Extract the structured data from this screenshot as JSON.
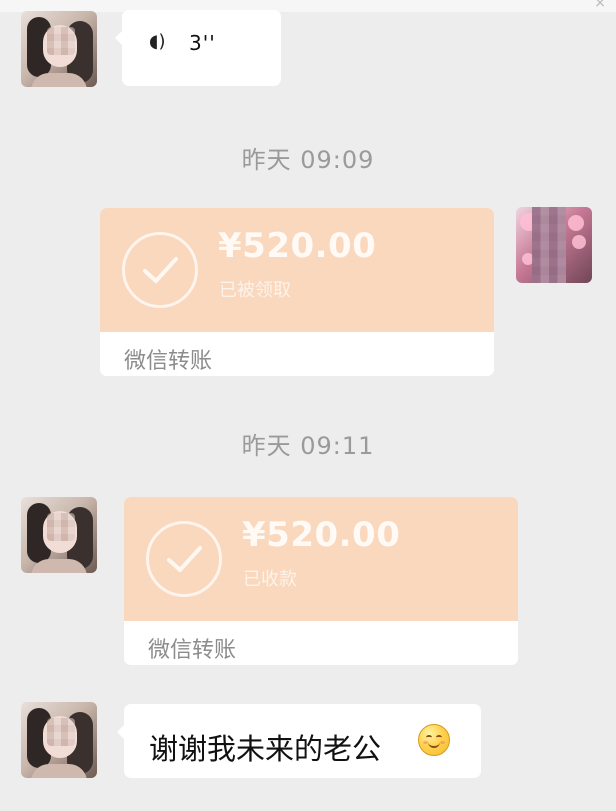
{
  "messages": {
    "voice": {
      "duration": "3''",
      "icon": "voice-message-icon"
    },
    "timestamp_1": "昨天 09:09",
    "transfer_1": {
      "amount": "¥520.00",
      "status": "已被领取",
      "source": "微信转账",
      "icon": "check-circle-icon"
    },
    "timestamp_2": "昨天 09:11",
    "transfer_2": {
      "amount": "¥520.00",
      "status": "已收款",
      "source": "微信转账",
      "icon": "check-circle-icon"
    },
    "text_message": {
      "text": "谢谢我未来的老公",
      "emoji": "smiling-face-emoji"
    }
  },
  "theme": {
    "background": "#ededed",
    "bubble": "#ffffff",
    "transfer": "#f9d8bd",
    "text": "#111111",
    "timestamp": "#9a9a9a"
  }
}
